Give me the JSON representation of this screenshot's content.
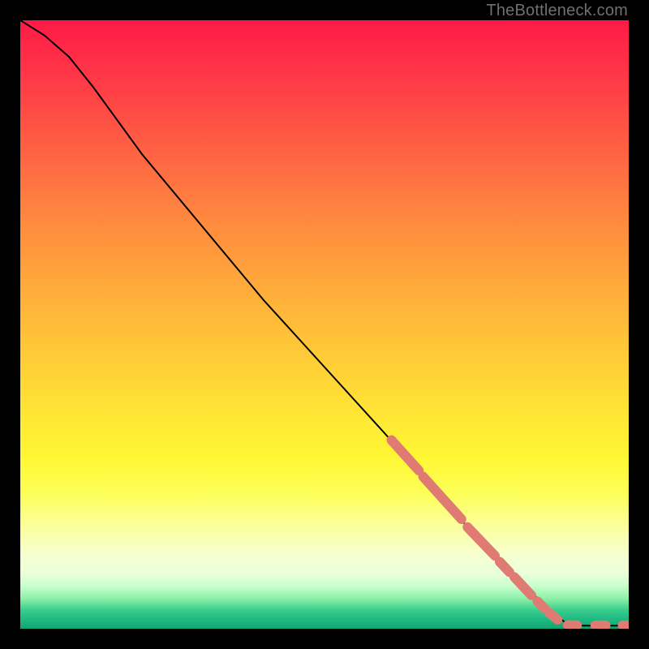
{
  "attribution": "TheBottleneck.com",
  "chart_data": {
    "type": "line",
    "title": "",
    "xlabel": "",
    "ylabel": "",
    "xlim": [
      0,
      100
    ],
    "ylim": [
      0,
      100
    ],
    "grid": false,
    "series": [
      {
        "name": "curve",
        "stroke": "#000000",
        "x": [
          0,
          4,
          8,
          12,
          20,
          30,
          40,
          50,
          60,
          67,
          75,
          82,
          87,
          90,
          92.5,
          95,
          97,
          99,
          100
        ],
        "y": [
          100,
          97.5,
          94,
          89,
          78,
          66,
          54,
          43,
          32,
          24,
          15,
          8,
          3,
          0.7,
          0.5,
          0.5,
          0.5,
          0.5,
          0.5
        ]
      }
    ],
    "markers": [
      {
        "type": "dash_along_curve",
        "color": "#e07b74",
        "segments": [
          {
            "x0": 61,
            "y0": 31,
            "x1": 65.5,
            "y1": 26
          },
          {
            "x0": 66.2,
            "y0": 25,
            "x1": 72.5,
            "y1": 18
          },
          {
            "x0": 73.5,
            "y0": 16.7,
            "x1": 78,
            "y1": 12
          },
          {
            "x0": 78.8,
            "y0": 11,
            "x1": 80.4,
            "y1": 9.3
          },
          {
            "x0": 81.2,
            "y0": 8.5,
            "x1": 84,
            "y1": 5.5
          },
          {
            "x0": 85,
            "y0": 4.5,
            "x1": 86.2,
            "y1": 3.3
          },
          {
            "x0": 87,
            "y0": 2.6,
            "x1": 88.3,
            "y1": 1.5
          }
        ]
      },
      {
        "type": "flat_dots",
        "color": "#e07b74",
        "points": [
          {
            "x": 90,
            "y": 0.6
          },
          {
            "x": 91.5,
            "y": 0.55
          },
          {
            "x": 94.5,
            "y": 0.55
          },
          {
            "x": 96.2,
            "y": 0.55
          },
          {
            "x": 99.0,
            "y": 0.55
          },
          {
            "x": 100.0,
            "y": 0.55
          }
        ]
      }
    ]
  },
  "colors": {
    "marker": "#e07b74",
    "curve": "#000000"
  }
}
